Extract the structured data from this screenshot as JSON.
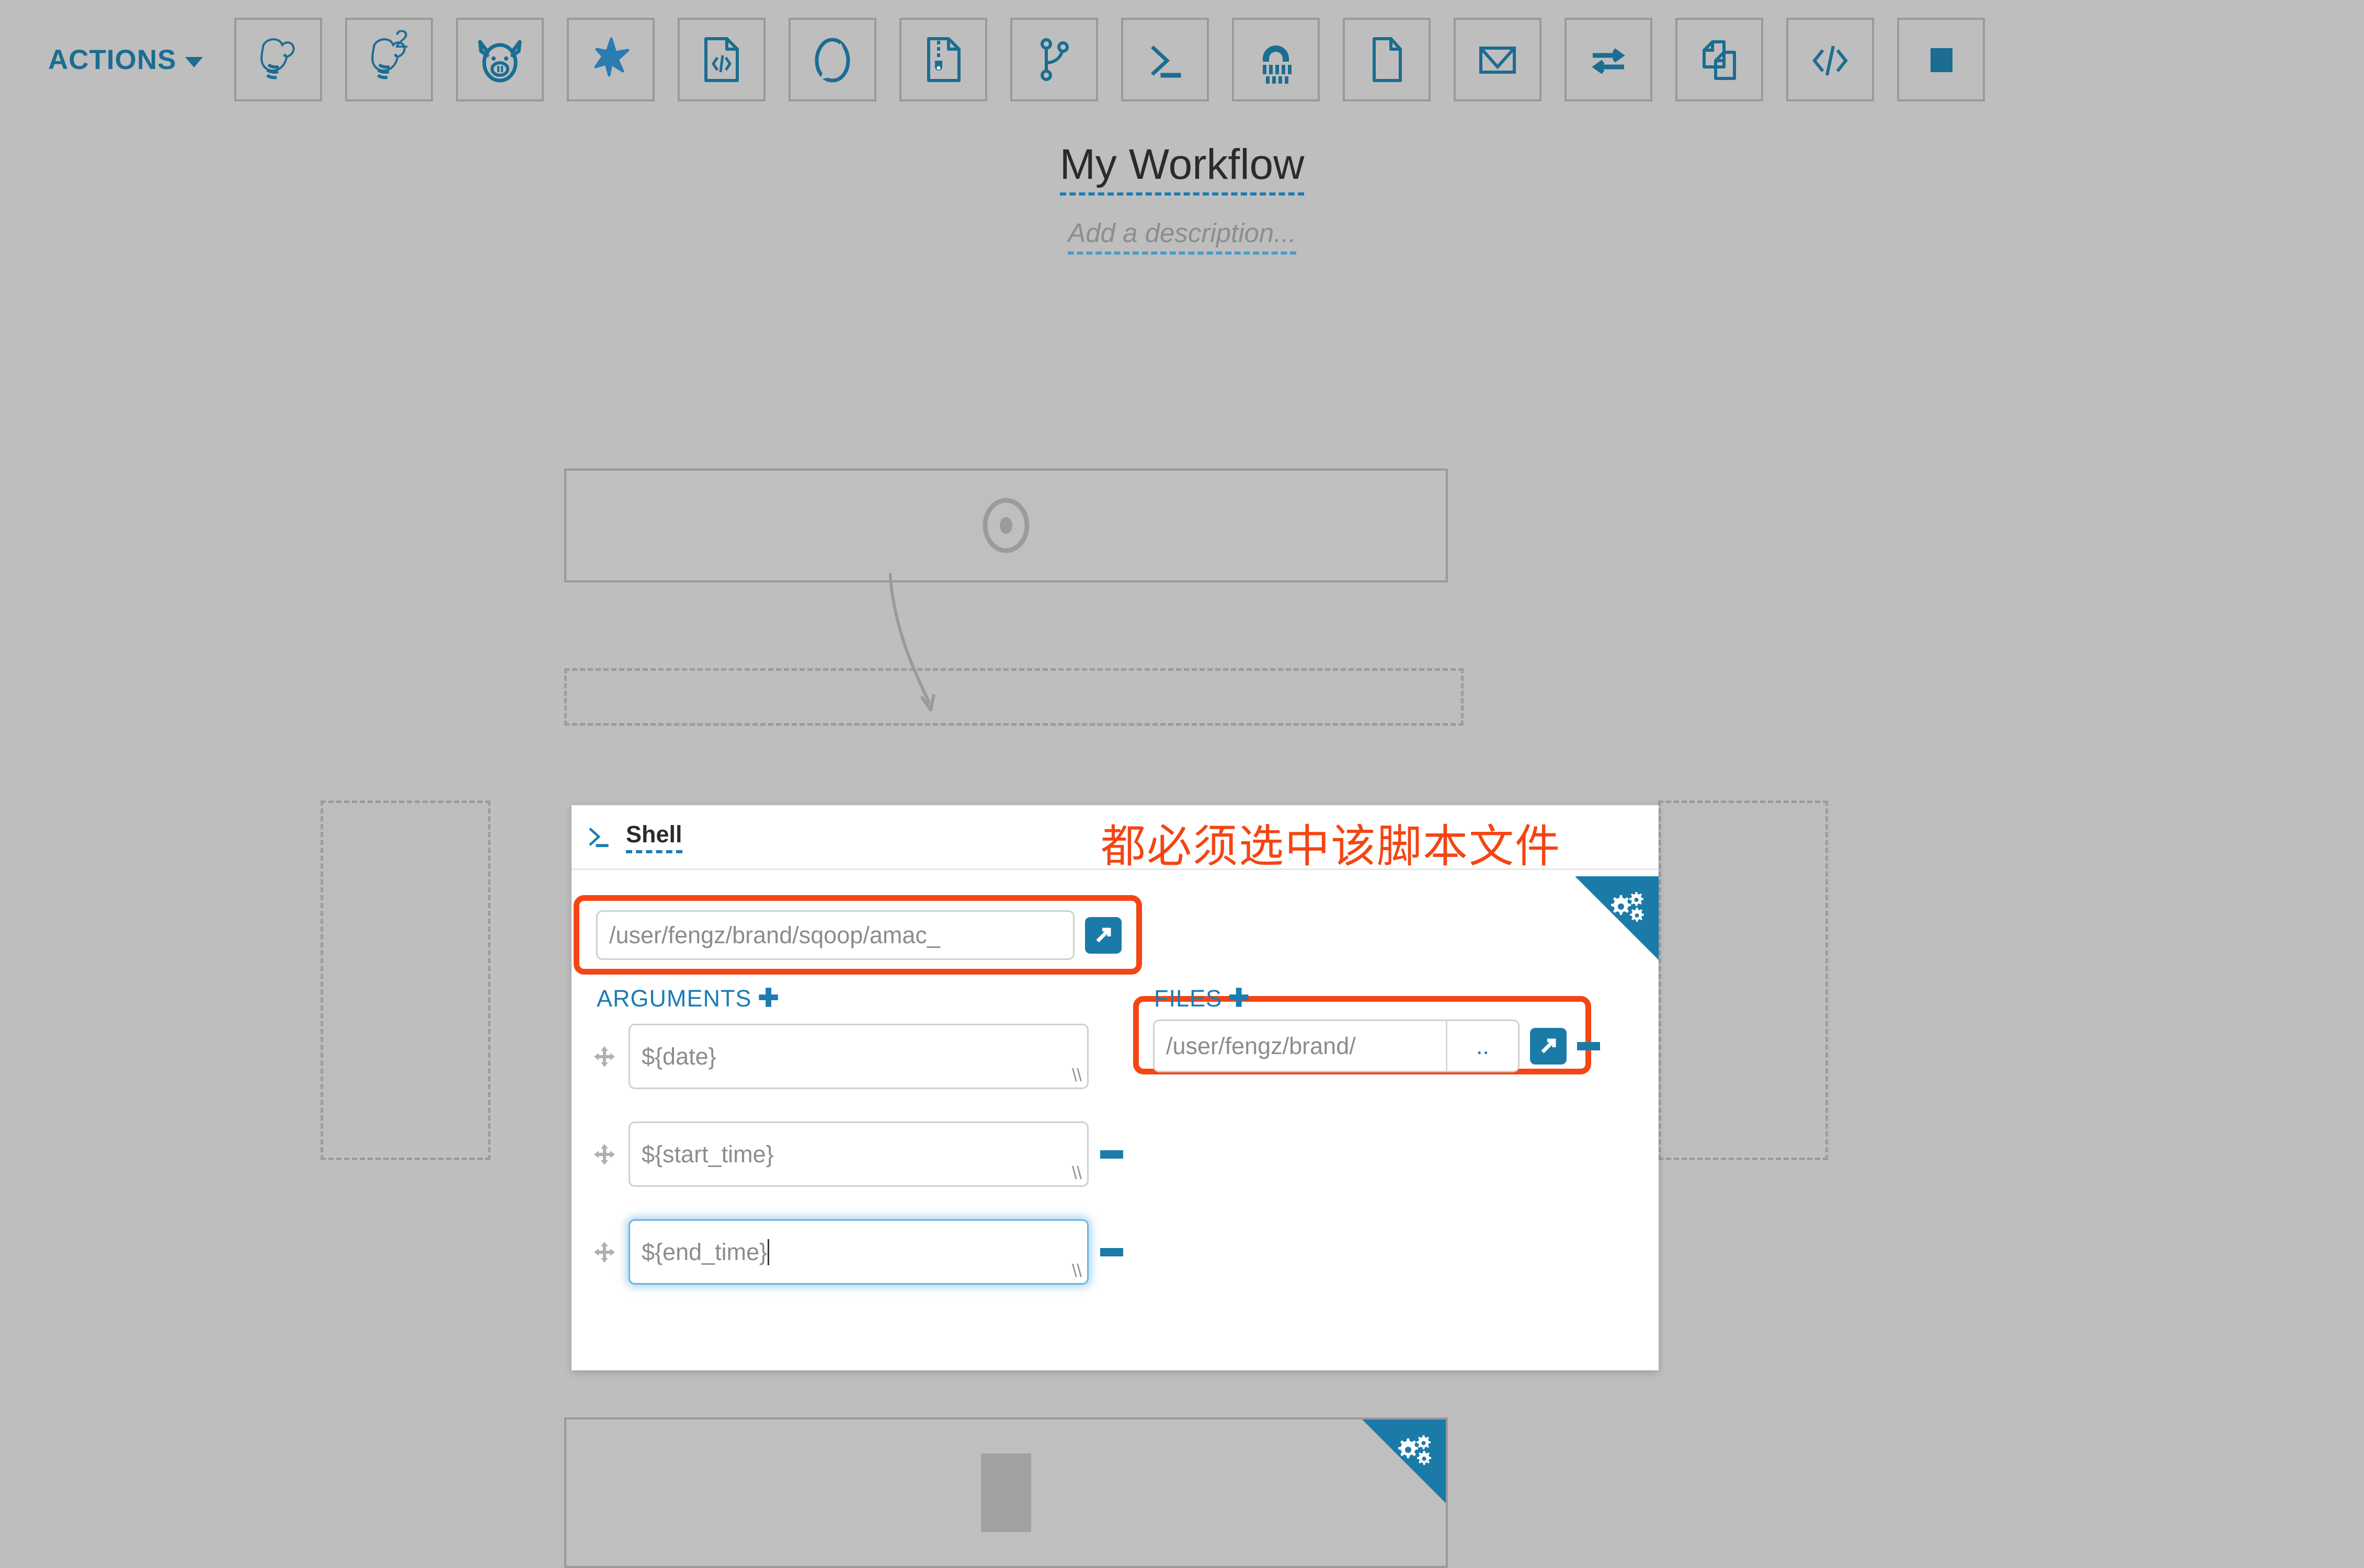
{
  "toolbar": {
    "actions_label": "ACTIONS",
    "caret_icon": "caret-down-icon",
    "buttons": [
      {
        "name": "hive-action",
        "icon": "hive-elephant-icon",
        "sup": ""
      },
      {
        "name": "hive2-action",
        "icon": "hive-elephant-icon",
        "sup": "2"
      },
      {
        "name": "pig-action",
        "icon": "pig-icon",
        "sup": ""
      },
      {
        "name": "spark-action",
        "icon": "spark-star-icon",
        "sup": ""
      },
      {
        "name": "java-action",
        "icon": "code-document-icon",
        "sup": ""
      },
      {
        "name": "sqoop-action",
        "icon": "sqoop-circle-icon",
        "sup": ""
      },
      {
        "name": "distcp-action",
        "icon": "zipped-document-icon",
        "sup": ""
      },
      {
        "name": "fork-action",
        "icon": "fork-branch-icon",
        "sup": ""
      },
      {
        "name": "shell-action",
        "icon": "shell-prompt-icon",
        "sup": ""
      },
      {
        "name": "mapreduce-action",
        "icon": "hadoop-mapreduce-icon",
        "sup": ""
      },
      {
        "name": "file-action",
        "icon": "document-icon",
        "sup": ""
      },
      {
        "name": "email-action",
        "icon": "envelope-icon",
        "sup": ""
      },
      {
        "name": "transfer-action",
        "icon": "two-way-arrows-icon",
        "sup": ""
      },
      {
        "name": "copy-action",
        "icon": "copy-documents-icon",
        "sup": ""
      },
      {
        "name": "markup-action",
        "icon": "angle-brackets-icon",
        "sup": ""
      },
      {
        "name": "stop-action",
        "icon": "filled-square-icon",
        "sup": ""
      }
    ]
  },
  "workflow": {
    "title": "My Workflow",
    "description_placeholder": "Add a description...",
    "start_node_icon": "bullseye-target-icon",
    "end_node_icon": "stop-square-icon"
  },
  "annotation": {
    "text": "都必须选中该脚本文件",
    "color": "#f44514"
  },
  "shell_card": {
    "action_type": "Shell",
    "action_icon": "shell-prompt-icon",
    "settings_badge_icon": "cogs-icon",
    "script": {
      "value": "/user/fengz/brand/sqoop/amac_",
      "browse_icon": "external-link-icon"
    },
    "arguments": {
      "label": "ARGUMENTS",
      "add_icon": "plus-icon",
      "items": [
        {
          "value": "${date}",
          "focused": false,
          "drag_icon": "move-cross-icon",
          "remove_icon": "minus-icon"
        },
        {
          "value": "${start_time}",
          "focused": false,
          "drag_icon": "move-cross-icon",
          "remove_icon": "minus-icon"
        },
        {
          "value": "${end_time}",
          "focused": true,
          "drag_icon": "move-cross-icon",
          "remove_icon": "minus-icon"
        }
      ]
    },
    "files": {
      "label": "FILES",
      "add_icon": "plus-icon",
      "items": [
        {
          "value": "/user/fengz/brand/",
          "dots": "..",
          "browse_icon": "external-link-icon",
          "remove_icon": "minus-icon"
        }
      ]
    }
  },
  "colors": {
    "canvas_bg": "#bebebe",
    "accent_blue": "#1b7ba8",
    "link_blue": "#1b7cb5",
    "highlight_red": "#f44514",
    "focus_blue": "#6cb3e4",
    "card_white": "#ffffff"
  }
}
